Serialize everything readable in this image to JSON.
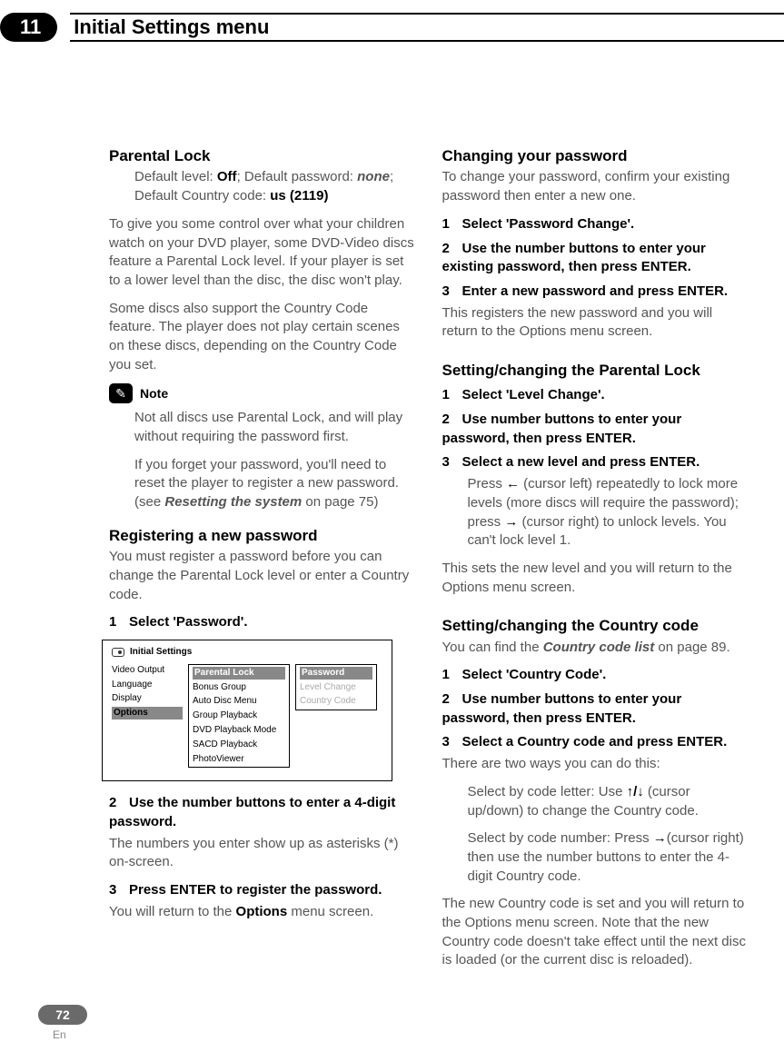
{
  "chapter": {
    "number": "11",
    "title": "Initial Settings menu"
  },
  "left": {
    "h_parental": "Parental Lock",
    "defaults": {
      "line_prefix": "Default level: ",
      "off": "Off",
      "sep": "; Default password: ",
      "none": "none",
      "sep2": ";",
      "cc_prefix": "Default Country code: ",
      "cc": "us (2119)"
    },
    "p1": "To give you some control over what your children watch on your DVD player, some DVD-Video discs feature a Parental Lock level. If your player is set to a lower level than the disc, the disc won't play.",
    "p2": "Some discs also support the Country Code feature. The player does not play certain scenes on these discs, depending on the Country Code you set.",
    "note_label": "Note",
    "n1": "Not all discs use Parental Lock, and will play without requiring the password first.",
    "n2_a": "If you forget your password, you'll need to reset the player to register a new password. (see ",
    "n2_em": "Resetting the system",
    "n2_b": " on page 75)",
    "h_reg": "Registering a new password",
    "reg_p": "You must register a password before you can change the Parental Lock level or enter a Country code.",
    "s1": "Select 'Password'.",
    "menu": {
      "title": "Initial Settings",
      "col1": [
        "Video Output",
        "Language",
        "Display",
        "Options"
      ],
      "col2": [
        "Parental  Lock",
        "Bonus Group",
        "Auto Disc Menu",
        "Group Playback",
        "DVD Playback Mode",
        "SACD Playback",
        "PhotoViewer"
      ],
      "col3": [
        "Password",
        "Level Change",
        "Country Code"
      ]
    },
    "s2": "Use the number buttons to enter a 4-digit password.",
    "s2_after": "The numbers you enter show up as asterisks (*) on-screen.",
    "s3": "Press ENTER to register the password.",
    "s3_after_a": "You will return to the ",
    "s3_after_b": "Options",
    "s3_after_c": " menu screen."
  },
  "right": {
    "h_change": "Changing your password",
    "change_p": "To change your password, confirm your existing password then enter a new one.",
    "c1": "Select 'Password Change'.",
    "c2": "Use the number buttons to enter your existing password, then press ENTER.",
    "c3": "Enter a new password and press ENTER.",
    "c3_after": "This registers the new password and you will return to the Options menu screen.",
    "h_setlock": "Setting/changing the Parental Lock",
    "l1": "Select 'Level Change'.",
    "l2": "Use number buttons to enter your password, then press ENTER.",
    "l3": "Select a new level and press ENTER.",
    "l3_sub_a": "Press ",
    "l3_sub_b": " (cursor left) repeatedly to lock more levels (more discs will require the password); press ",
    "l3_sub_c": " (cursor right) to unlock levels. You can't lock level 1.",
    "l_after": "This sets the new level and you will return to the Options menu screen.",
    "h_setcc": "Setting/changing the Country code",
    "cc_p_a": "You can find the ",
    "cc_p_em": "Country code list",
    "cc_p_b": " on page 89.",
    "cc1": "Select 'Country Code'.",
    "cc2": "Use number buttons to enter your password, then press ENTER.",
    "cc3": "Select a Country code and press ENTER.",
    "cc3_after": "There are two ways you can do this:",
    "cc_sub1_a": "Select by code letter: Use ",
    "cc_sub1_b": " (cursor up/down) to change the Country code.",
    "cc_sub2_a": "Select by code number: Press ",
    "cc_sub2_b": "(cursor right) then use the number buttons to enter the 4-digit Country code.",
    "cc_final": "The new Country code is set and you will return to the Options menu screen. Note that the new Country code doesn't take effect until the next disc is loaded (or the current disc is reloaded)."
  },
  "footer": {
    "page": "72",
    "lang": "En"
  },
  "arrows": {
    "left": "←",
    "right": "→",
    "up": "↑",
    "down": "↓",
    "sep": "/"
  }
}
